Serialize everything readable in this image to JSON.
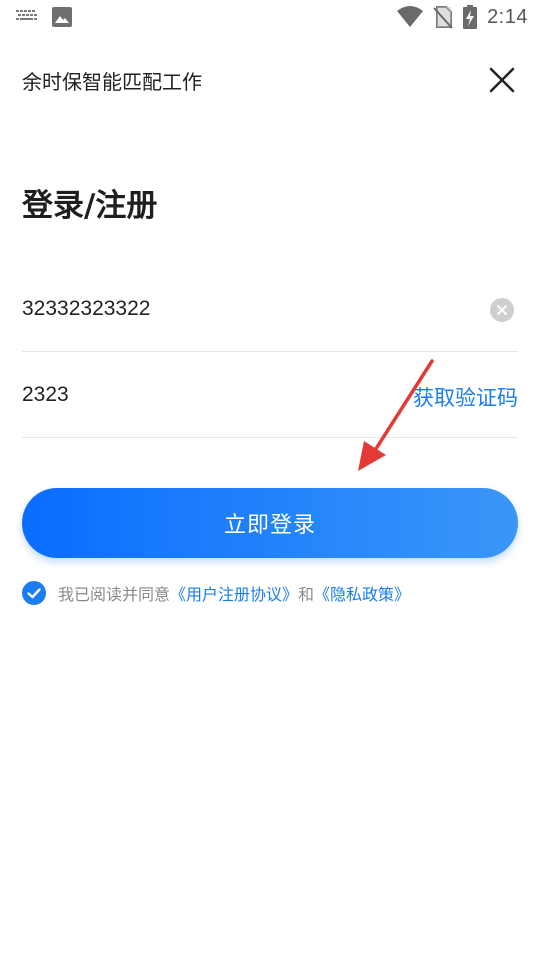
{
  "status_bar": {
    "time": "2:14",
    "icons": [
      "keyboard-icon",
      "image-icon",
      "wifi-icon",
      "no-sim-icon",
      "battery-charging-icon"
    ]
  },
  "header": {
    "title": "余时保智能匹配工作",
    "close_icon": "close-icon"
  },
  "heading": "登录/注册",
  "phone_field": {
    "value": "32332323322",
    "clear_icon": "clear-icon"
  },
  "code_field": {
    "value": "2323",
    "get_code_label": "获取验证码"
  },
  "login_button": {
    "label": "立即登录"
  },
  "agreement": {
    "checked": true,
    "prefix": "我已阅读并同意",
    "user_agreement": "《用户注册协议》",
    "conjunction": "和",
    "privacy_policy": "《隐私政策》"
  },
  "colors": {
    "accent": "#1a7df0",
    "button_gradient_start": "#0a6dff",
    "button_gradient_end": "#3a97f8",
    "annotation_arrow": "#e53935"
  }
}
